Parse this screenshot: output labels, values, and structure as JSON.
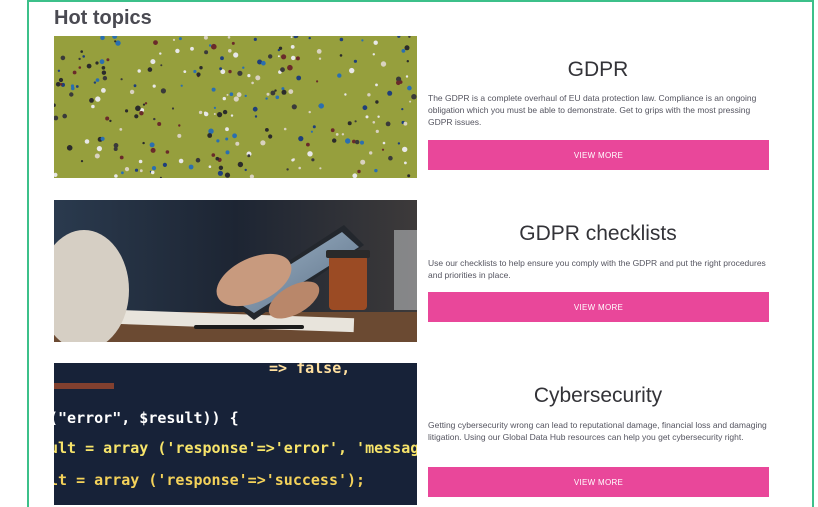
{
  "section_title": "Hot topics",
  "cards": [
    {
      "title": "GDPR",
      "description": "The GDPR is a complete overhaul of EU data protection law. Compliance is an ongoing obligation which you must be able to demonstrate. Get to grips with the most pressing GDPR issues.",
      "button_label": "VIEW MORE",
      "image": "crowd-on-grass-image"
    },
    {
      "title": "GDPR checklists",
      "description": "Use our checklists to help ensure you comply with the GDPR and put the right procedures and priorities in place.",
      "button_label": "VIEW MORE",
      "image": "hands-holding-tablet-image"
    },
    {
      "title": "Cybersecurity",
      "description": "Getting cybersecurity wrong can lead to reputational damage, financial loss and damaging litigation. Using our Global Data Hub resources can help you get cybersecurity right.",
      "button_label": "VIEW MORE",
      "image": "code-on-screen-image"
    }
  ],
  "code_lines": [
    "=> false,",
    "(\"error\", $result)) {",
    "ult = array ('response'=>'error', 'messag",
    "lt = array ('response'=>'success');"
  ],
  "colors": {
    "accent": "#e9479a",
    "frame": "#3cc08a",
    "title": "#333338"
  }
}
